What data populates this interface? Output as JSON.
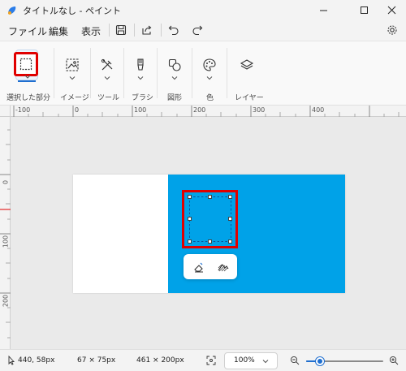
{
  "window": {
    "title": "タイトルなし - ペイント"
  },
  "menu": {
    "items": [
      "ファイル",
      "編集",
      "表示"
    ]
  },
  "ribbon": {
    "groups": [
      {
        "label": "選択した部分",
        "icon": "selection-icon"
      },
      {
        "label": "イメージ",
        "icon": "image-icon"
      },
      {
        "label": "ツール",
        "icon": "tools-icon"
      },
      {
        "label": "ブラシ",
        "icon": "brush-icon"
      },
      {
        "label": "図形",
        "icon": "shapes-icon"
      },
      {
        "label": "色",
        "icon": "palette-icon"
      },
      {
        "label": "レイヤー",
        "icon": "layers-icon"
      }
    ]
  },
  "ruler": {
    "horizontal": [
      "-100",
      "0",
      "100",
      "200",
      "300",
      "400"
    ],
    "vertical": [
      "0",
      "100",
      "200"
    ]
  },
  "canvas": {
    "background_color": "#ffffff",
    "fill_color": "#00a2e8",
    "highlight_color": "#e00000"
  },
  "status": {
    "cursor_position": "440, 58px",
    "selection_size": "67 × 75px",
    "canvas_size": "461 × 200px",
    "zoom": "100%",
    "zoom_slider_fraction": 0.18
  }
}
